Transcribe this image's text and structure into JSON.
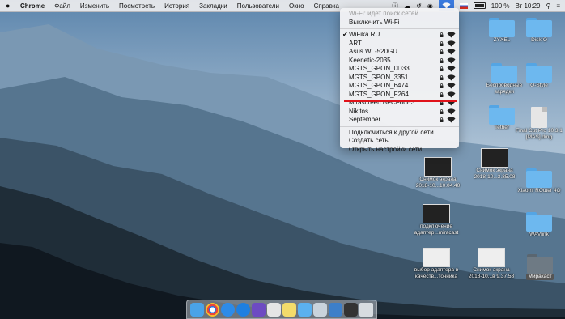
{
  "menubar": {
    "app_name": "Chrome",
    "items": [
      "Файл",
      "Изменить",
      "Посмотреть",
      "История",
      "Закладки",
      "Пользователи",
      "Окно",
      "Справка"
    ],
    "battery": "100 %",
    "clock": "Вт 10:29"
  },
  "wifi_menu": {
    "status": "Wi-Fi: идет поиск сетей...",
    "turn_off": "Выключить Wi-Fi",
    "networks": [
      {
        "name": "WiFika.RU",
        "checked": true,
        "locked": true
      },
      {
        "name": "ART",
        "checked": false,
        "locked": true
      },
      {
        "name": "Asus WL-520GU",
        "checked": false,
        "locked": true
      },
      {
        "name": "Keenetic-2035",
        "checked": false,
        "locked": true
      },
      {
        "name": "MGTS_GPON_0D33",
        "checked": false,
        "locked": true
      },
      {
        "name": "MGTS_GPON_3351",
        "checked": false,
        "locked": true
      },
      {
        "name": "MGTS_GPON_6474",
        "checked": false,
        "locked": true
      },
      {
        "name": "MGTS_GPON_F264",
        "checked": false,
        "locked": true
      },
      {
        "name": "Mirascreen BFCF66E3",
        "checked": false,
        "locked": true
      },
      {
        "name": "Nikitos",
        "checked": false,
        "locked": true
      },
      {
        "name": "September",
        "checked": false,
        "locked": true
      }
    ],
    "join_other": "Подключиться к другой сети...",
    "create_network": "Создать сеть...",
    "open_prefs": "Открыть настройки сети..."
  },
  "desktop": {
    "disk": "Disk-O",
    "zyxel": "ZYXEL",
    "ostyle": "O-Style",
    "wireless": [
      "Беспроводные",
      "зарядки"
    ],
    "tether": "Tether",
    "fcp": [
      "Final Cut Pro 10.3.1",
      "[MAS].dmg"
    ],
    "shot1": [
      "Снимок экрана",
      "2018-10...10.04.40"
    ],
    "shot2": [
      "Снимок экрана",
      "2018-10...3.35.08"
    ],
    "xiaomi": "Xiaomi ROuter 4Q",
    "podkl": [
      "подключение",
      "адаптер...miracast"
    ],
    "wavlink": "WAVlink",
    "vybor": [
      "выбор адаптера в",
      "качеств...точника"
    ],
    "shot3": [
      "Снимок экрана",
      "2018-10...в 9.37.58"
    ],
    "miracast": "Миракаст"
  },
  "dock": {
    "icons": [
      "finder-icon",
      "chrome-icon",
      "safari-icon",
      "app-store-icon",
      "imovie-icon",
      "photos-icon",
      "notes-icon",
      "downloads-folder-icon",
      "screenshot-icon",
      "mail-icon",
      "terminal-icon",
      "trash-icon"
    ]
  }
}
